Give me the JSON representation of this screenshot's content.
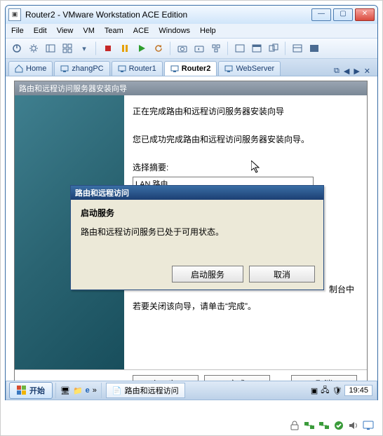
{
  "window": {
    "title": "Router2 - VMware Workstation ACE Edition"
  },
  "menu": {
    "file": "File",
    "edit": "Edit",
    "view": "View",
    "vm": "VM",
    "team": "Team",
    "ace": "ACE",
    "windows": "Windows",
    "help": "Help"
  },
  "tabs": {
    "items": [
      {
        "label": "Home"
      },
      {
        "label": "zhangPC"
      },
      {
        "label": "Router1"
      },
      {
        "label": "Router2"
      },
      {
        "label": "WebServer"
      }
    ]
  },
  "wizard": {
    "title": "路由和远程访问服务器安装向导",
    "line1": "正在完成路由和远程访问服务器安装向导",
    "line2": "您已成功完成路由和远程访问服务器安装向导。",
    "summary_label": "选择摘要:",
    "summary_value": "LAN 路由",
    "behind_text1": "制台中",
    "behind_text2": "若要关闭该向导，请单击“完成”。",
    "buttons": {
      "back": "< 上一步(B)",
      "finish": "完成",
      "cancel": "取消"
    }
  },
  "dialog": {
    "title": "路由和远程访问",
    "heading": "启动服务",
    "body": "路由和远程访问服务已处于可用状态。",
    "buttons": {
      "start": "启动服务",
      "cancel": "取消"
    }
  },
  "taskbar": {
    "start": "开始",
    "task1": "路由和远程访问",
    "clock": "19:45"
  }
}
